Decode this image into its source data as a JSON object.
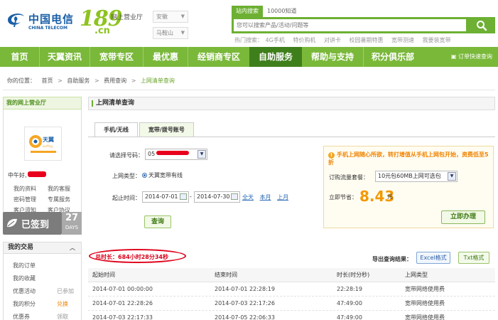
{
  "header": {
    "logo_cn": "中国电信",
    "logo_en": "CHINA TELECOM",
    "logo_189": "189",
    "logo_cn_suffix": ".cn",
    "logo_tagline": "网上营业厅",
    "province_select": "安徽",
    "city_select": "马鞍山",
    "search_tabs": [
      "站内搜索",
      "10000知道"
    ],
    "search_placeholder": "您可以搜索产品/活动/问题等",
    "hot_label": "热门搜索：",
    "hot_words": [
      "4G手机",
      "特价购机",
      "对讲卡",
      "校园暑期特惠",
      "宽带测速",
      "我要装宽带"
    ]
  },
  "nav": {
    "items": [
      "首页",
      "天翼资讯",
      "宽带专区",
      "最优惠",
      "经销商专区",
      "自助服务",
      "帮助与支持",
      "积分俱乐部"
    ],
    "active": "自助服务",
    "fast_link": "订单快速查询"
  },
  "breadcrumb": {
    "label": "你的位置：",
    "items": [
      "首页",
      "自助服务",
      "费用查询"
    ],
    "current": "上网清单查询"
  },
  "left": {
    "title": "我的网上营业厅",
    "greeting": "中午好,",
    "links": [
      "我的资料",
      "我的客服",
      "密码管理",
      "专属服务",
      "客户须知",
      "客户协议"
    ],
    "checkin_label": "已签到",
    "checkin_days": "27",
    "checkin_days_unit": "DAYS",
    "trade_title": "我的交易",
    "trade_items": [
      {
        "label": "我的订单",
        "tag": ""
      },
      {
        "label": "我的收藏",
        "tag": ""
      },
      {
        "label": "优惠活动",
        "tag": "已参加"
      },
      {
        "label": "我的积分",
        "tag": "兑换"
      },
      {
        "label": "优惠券",
        "tag": "领取"
      }
    ]
  },
  "main": {
    "title": "上网清单查询",
    "tabs": [
      "手机/无线",
      "宽带/拨号账号"
    ],
    "active_tab": "宽带/拨号账号",
    "form": {
      "number_label": "请选择号码：",
      "number_value": "05",
      "type_label": "上网类型：",
      "type_value": "天翼宽带有线",
      "time_label": "起止时间：",
      "start_date": "2014-07-01",
      "end_date": "2014-07-30",
      "dash": "-",
      "quick_ranges": [
        "全天",
        "本月",
        "上月"
      ],
      "query_button": "查询"
    },
    "promo": {
      "notice": "手机上网随心所欲，转打增值从手机上网包开始，资费低至5折",
      "package_label": "订购流量套餐：",
      "package_value": "10元包60MB上网可选包",
      "save_label": "立即节省：",
      "save_value": "8.43",
      "save_unit": "元",
      "apply_button": "立即办理"
    },
    "total_label": "总时长：",
    "total_value": "684小时28分34秒",
    "export_label": "导出查询结果：",
    "export_excel": "Excel格式",
    "export_txt": "Txt格式",
    "table": {
      "headers": [
        "起始时间",
        "结束时间",
        "时长(时分秒)",
        "上网类型"
      ],
      "rows": [
        [
          "2014-07-01 00:00:00",
          "2014-07-01 22:28:19",
          "22:28:19",
          "宽带网络使用费"
        ],
        [
          "2014-07-01 22:28:26",
          "2014-07-03 22:17:26",
          "47:49:00",
          "宽带网络使用费"
        ],
        [
          "2014-07-03 22:17:33",
          "2014-07-05 22:06:33",
          "47:49:00",
          "宽带网络使用费"
        ]
      ]
    }
  },
  "colors": {
    "brand_green": "#7ab83a",
    "nav_active": "#3f7f1b",
    "logo_blue": "#1a5fa8",
    "accent_orange": "#f39800",
    "alert_red": "#d9001b"
  }
}
